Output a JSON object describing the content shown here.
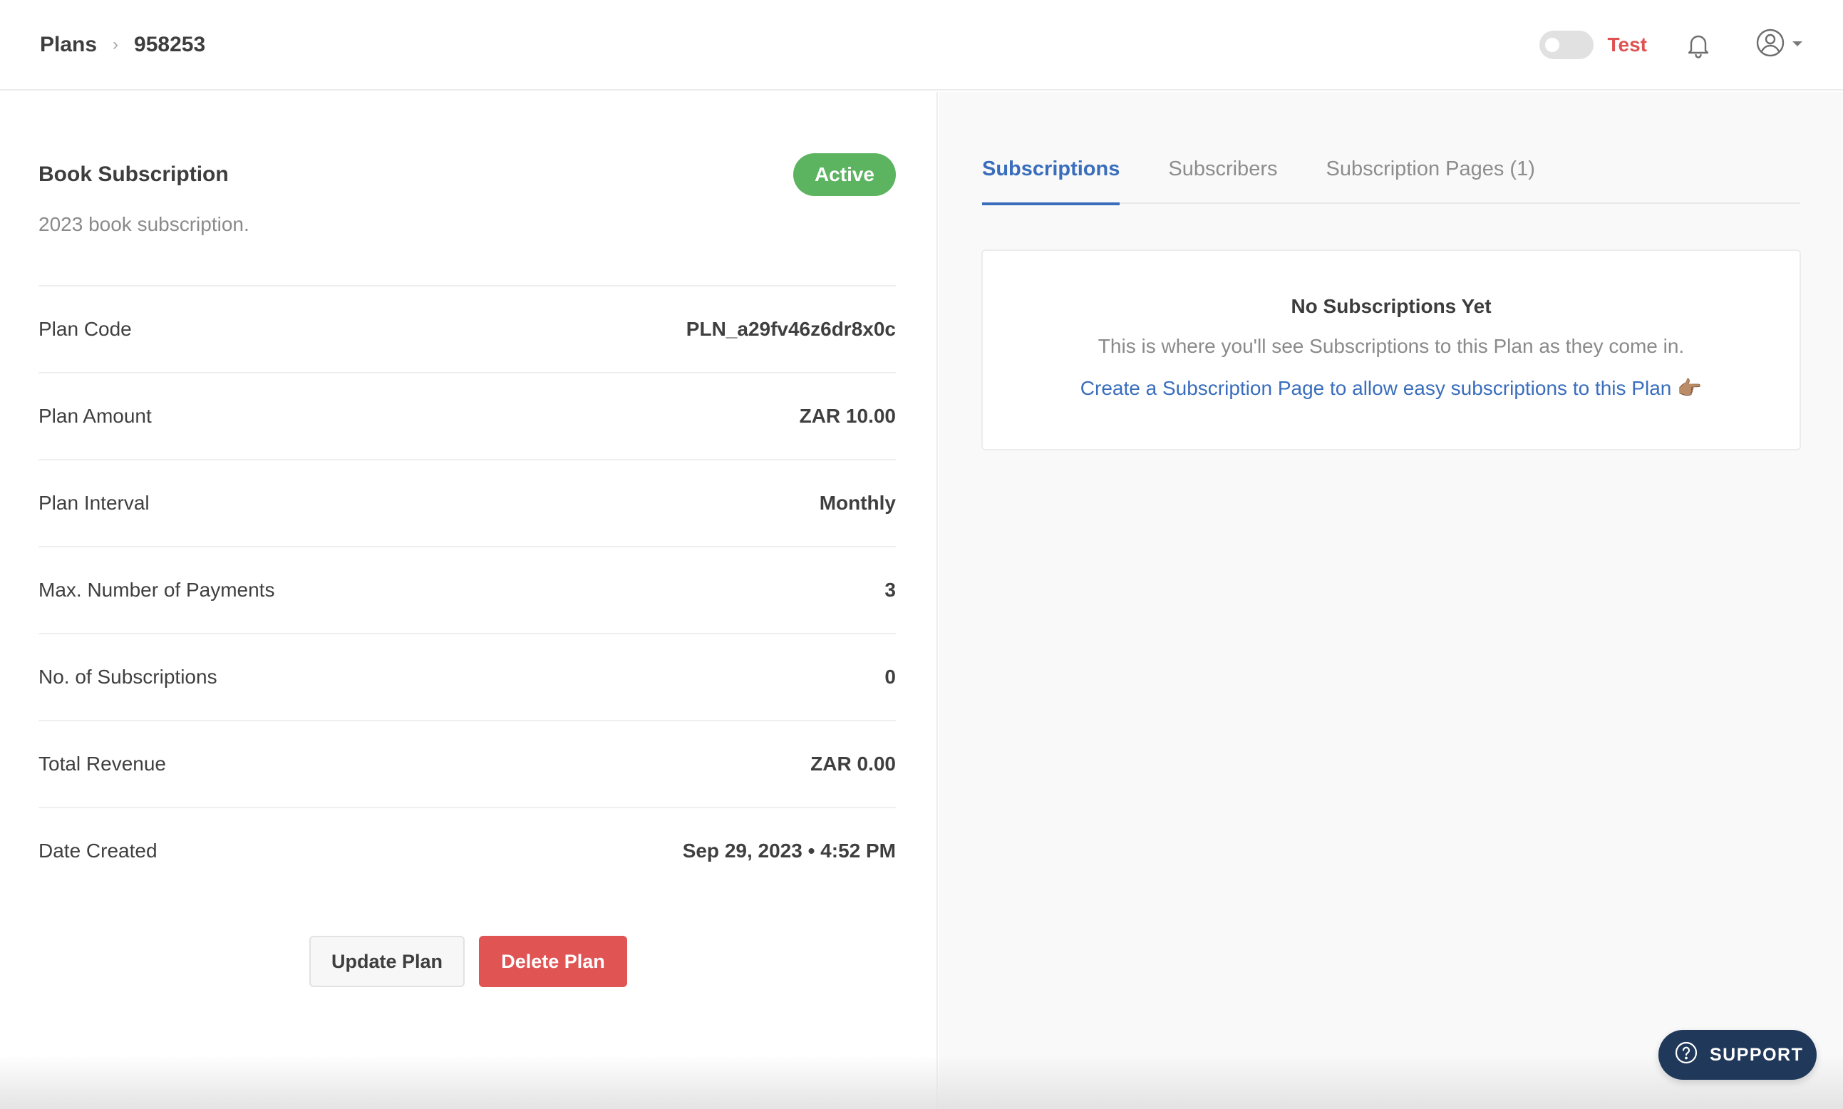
{
  "header": {
    "breadcrumb_root": "Plans",
    "breadcrumb_separator": "›",
    "breadcrumb_current": "958253",
    "mode_label": "Test"
  },
  "plan": {
    "name": "Book Subscription",
    "status": "Active",
    "description": "2023 book subscription.",
    "details": [
      {
        "label": "Plan Code",
        "value": "PLN_a29fv46z6dr8x0c"
      },
      {
        "label": "Plan Amount",
        "value": "ZAR 10.00"
      },
      {
        "label": "Plan Interval",
        "value": "Monthly"
      },
      {
        "label": "Max. Number of Payments",
        "value": "3"
      },
      {
        "label": "No. of Subscriptions",
        "value": "0"
      },
      {
        "label": "Total Revenue",
        "value": "ZAR 0.00"
      },
      {
        "label": "Date Created",
        "value": "Sep 29, 2023 • 4:52 PM"
      }
    ],
    "update_label": "Update Plan",
    "delete_label": "Delete Plan"
  },
  "tabs": [
    {
      "label": "Subscriptions",
      "active": true
    },
    {
      "label": "Subscribers",
      "active": false
    },
    {
      "label": "Subscription Pages (1)",
      "active": false
    }
  ],
  "empty_state": {
    "title": "No Subscriptions Yet",
    "text": "This is where you'll see Subscriptions to this Plan as they come in.",
    "link": "Create a Subscription Page to allow easy subscriptions to this Plan",
    "link_emoji": "👉🏽"
  },
  "support": {
    "label": "SUPPORT"
  },
  "colors": {
    "accent": "#3a6ebc",
    "active_badge": "#5cb360",
    "danger": "#e05454",
    "test_mode": "#e05252",
    "support_bg": "#20385a"
  },
  "icons": [
    "bell-icon",
    "user-circle-icon",
    "caret-down-icon",
    "help-circle-icon"
  ]
}
